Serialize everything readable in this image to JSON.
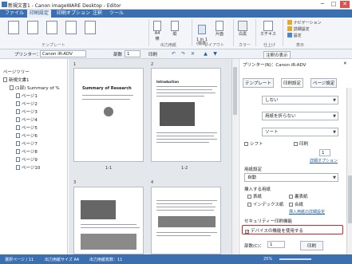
{
  "window": {
    "title": "新規文書1 - Canon imageWARE Desktop - Editor",
    "minimize": "─",
    "maximize": "□",
    "close": "✕"
  },
  "menu": {
    "items": [
      "ファイル",
      "印刷設定",
      "印刷オプション",
      "注釈",
      "ツール"
    ],
    "active_index": 1
  },
  "ribbon": {
    "template_group": "テンプレート",
    "paper_size": {
      "value": "A4",
      "label": "横"
    },
    "orientation_label": "縦",
    "paper_group": "出力用紙",
    "layout_value": "1 in 1\n(標準)",
    "duplex_label": "片面",
    "layout_group": "レイアウト",
    "color_label": "白黒",
    "color_group": "カラー",
    "staple_label": "ホチキス",
    "finish_group": "仕上げ",
    "navigation_label": "ナビゲーション",
    "detail_label": "詳細設定",
    "settings_label": "設定",
    "display_group": "表示"
  },
  "toolbar": {
    "printer_label": "プリンター：",
    "printer_value": "Canon iR-ADV",
    "copies_label": "部数",
    "copies_value": "1",
    "print_label": "印刷",
    "annotation_label": "注釈の表示"
  },
  "left_panel": {
    "title": "ページツリー",
    "tree": [
      {
        "label": "新規文書1",
        "level": 0
      },
      {
        "label": "(1部) Summary of %",
        "level": 1
      },
      {
        "label": "ページ1",
        "level": 2
      },
      {
        "label": "ページ2",
        "level": 2
      },
      {
        "label": "ページ3",
        "level": 2
      },
      {
        "label": "ページ4",
        "level": 2
      },
      {
        "label": "ページ5",
        "level": 2
      },
      {
        "label": "ページ6",
        "level": 2
      },
      {
        "label": "ページ7",
        "level": 2
      },
      {
        "label": "ページ8",
        "level": 2
      },
      {
        "label": "ページ9",
        "level": 2
      },
      {
        "label": "ページ10",
        "level": 2
      }
    ]
  },
  "document": {
    "pages": [
      {
        "number": "1",
        "caption": "1-1",
        "heading": "Summary of Research"
      },
      {
        "number": "2",
        "caption": "1-2",
        "heading": "Introduction"
      },
      {
        "number": "3",
        "caption": "",
        "heading": ""
      },
      {
        "number": "4",
        "caption": "",
        "heading": ""
      }
    ]
  },
  "right_panel": {
    "printer_label": "プリンター(N)：Canon iR-ADV",
    "tabs": [
      "テンプレート",
      "印刷設定",
      "ページ設定"
    ],
    "dropdowns": {
      "d1": "しない",
      "d2": "用紙を折らない",
      "d3": "ソート",
      "d4": "自動"
    },
    "shift_label": "シフト",
    "shift_value": "1",
    "print_check_label": "印刷",
    "detail_option_link": "詳細オプション",
    "paper_section_label": "用紙設定",
    "insert_label": "挿入する用紙",
    "opts": [
      "表紙",
      "裏表紙",
      "インデックス紙",
      "合紙"
    ],
    "insert_detail_link": "挿入用紙の詳細設定",
    "security_label": "セキュリティー印刷機能",
    "security_option": "デバイスの機能を使用する",
    "copies_label": "部数(C)：",
    "copies_value": "1",
    "print_button": "印刷"
  },
  "status": {
    "pages": "選択ページ / 11",
    "paper": "出力用紙サイズ  A4",
    "count": "出力用紙枚数：11",
    "zoom": "25%"
  },
  "colors": {
    "accent": "#3b6fb0",
    "highlight": "#d8232a"
  }
}
